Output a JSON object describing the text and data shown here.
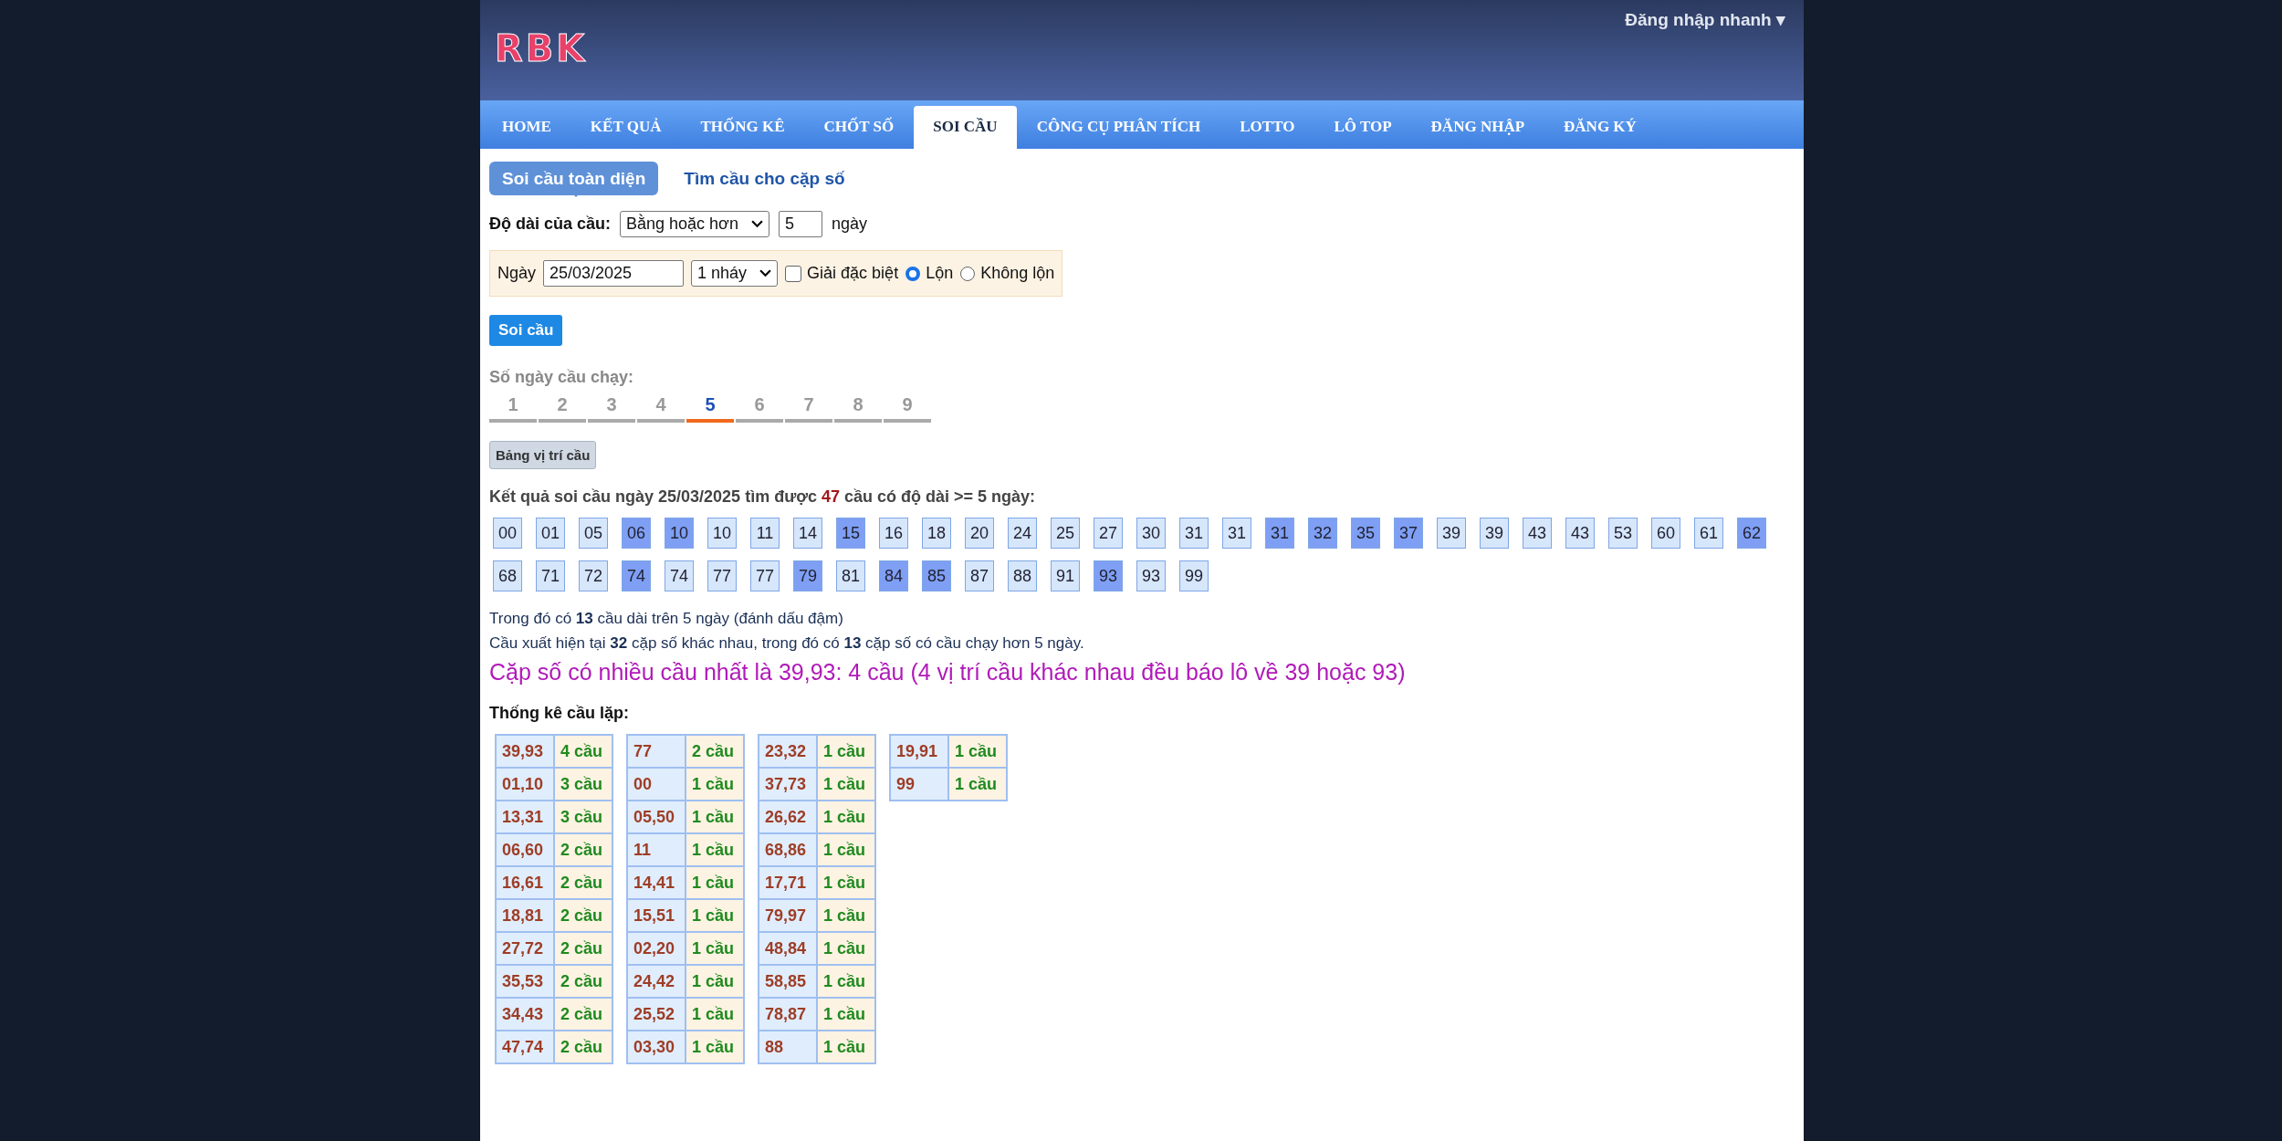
{
  "header": {
    "logo": "RBK",
    "login_menu": "Đăng nhập nhanh ▾"
  },
  "nav": [
    {
      "label": "HOME",
      "selected": false
    },
    {
      "label": "KẾT QUẢ",
      "selected": false
    },
    {
      "label": "THỐNG KÊ",
      "selected": false
    },
    {
      "label": "CHỐT SỐ",
      "selected": false
    },
    {
      "label": "SOI CẦU",
      "selected": true
    },
    {
      "label": "CÔNG CỤ PHÂN TÍCH",
      "selected": false
    },
    {
      "label": "LOTTO",
      "selected": false
    },
    {
      "label": "LÔ TOP",
      "selected": false
    },
    {
      "label": "ĐĂNG NHẬP",
      "selected": false
    },
    {
      "label": "ĐĂNG KÝ",
      "selected": false
    }
  ],
  "subtabs": [
    {
      "label": "Soi cầu toàn diện",
      "selected": true
    },
    {
      "label": "Tìm cầu cho cặp số",
      "selected": false
    }
  ],
  "length_row": {
    "label": "Độ dài của cầu:",
    "mode": "Bằng hoặc hơn",
    "days": "5",
    "unit": "ngày"
  },
  "date_row": {
    "label": "Ngày",
    "date": "25/03/2025",
    "step": "1 nháy",
    "options": [
      {
        "kind": "checkbox",
        "label": "Giải đặc biệt",
        "checked": false
      },
      {
        "kind": "radio",
        "label": "Lộn",
        "selected": true
      },
      {
        "kind": "radio",
        "label": "Không lộn",
        "selected": false
      }
    ]
  },
  "submit": "Soi cầu",
  "run_days": {
    "label": "Số ngày cầu chạy:",
    "items": [
      {
        "label": "1",
        "selected": false
      },
      {
        "label": "2",
        "selected": false
      },
      {
        "label": "3",
        "selected": false
      },
      {
        "label": "4",
        "selected": false
      },
      {
        "label": "5",
        "selected": true
      },
      {
        "label": "6",
        "selected": false
      },
      {
        "label": "7",
        "selected": false
      },
      {
        "label": "8",
        "selected": false
      },
      {
        "label": "9",
        "selected": false
      }
    ]
  },
  "position_button": "Bảng vị trí cầu",
  "result": {
    "summary": "Kết quả soi cầu ngày 25/03/2025 tìm được **47** cầu có độ dài >= 5 ngày:",
    "numbers": [
      {
        "value": "00",
        "highlighted": false
      },
      {
        "value": "01",
        "highlighted": false
      },
      {
        "value": "05",
        "highlighted": false
      },
      {
        "value": "06",
        "highlighted": true
      },
      {
        "value": "10",
        "highlighted": true
      },
      {
        "value": "10",
        "highlighted": false
      },
      {
        "value": "11",
        "highlighted": false
      },
      {
        "value": "14",
        "highlighted": false
      },
      {
        "value": "15",
        "highlighted": true
      },
      {
        "value": "16",
        "highlighted": false
      },
      {
        "value": "18",
        "highlighted": false
      },
      {
        "value": "20",
        "highlighted": false
      },
      {
        "value": "24",
        "highlighted": false
      },
      {
        "value": "25",
        "highlighted": false
      },
      {
        "value": "27",
        "highlighted": false
      },
      {
        "value": "30",
        "highlighted": false
      },
      {
        "value": "31",
        "highlighted": false
      },
      {
        "value": "31",
        "highlighted": false
      },
      {
        "value": "31",
        "highlighted": true
      },
      {
        "value": "32",
        "highlighted": true
      },
      {
        "value": "35",
        "highlighted": true
      },
      {
        "value": "37",
        "highlighted": true
      },
      {
        "value": "39",
        "highlighted": false
      },
      {
        "value": "39",
        "highlighted": false
      },
      {
        "value": "43",
        "highlighted": false
      },
      {
        "value": "43",
        "highlighted": false
      },
      {
        "value": "53",
        "highlighted": false
      },
      {
        "value": "60",
        "highlighted": false
      },
      {
        "value": "61",
        "highlighted": false
      },
      {
        "value": "62",
        "highlighted": true
      },
      {
        "value": "68",
        "highlighted": false
      },
      {
        "value": "71",
        "highlighted": false
      },
      {
        "value": "72",
        "highlighted": false
      },
      {
        "value": "74",
        "highlighted": true
      },
      {
        "value": "74",
        "highlighted": false
      },
      {
        "value": "77",
        "highlighted": false
      },
      {
        "value": "77",
        "highlighted": false
      },
      {
        "value": "79",
        "highlighted": true
      },
      {
        "value": "81",
        "highlighted": false
      },
      {
        "value": "84",
        "highlighted": true
      },
      {
        "value": "85",
        "highlighted": true
      },
      {
        "value": "87",
        "highlighted": false
      },
      {
        "value": "88",
        "highlighted": false
      },
      {
        "value": "91",
        "highlighted": false
      },
      {
        "value": "93",
        "highlighted": true
      },
      {
        "value": "93",
        "highlighted": false
      },
      {
        "value": "99",
        "highlighted": false
      }
    ],
    "notes": [
      "Trong đó có **13** cầu dài trên 5 ngày (đánh dấu đậm)",
      "Cầu xuất hiện tại **32** cặp số khác nhau, trong đó có **13** cặp số có cầu chạy hơn 5 ngày."
    ],
    "highlight": "Cặp số có nhiều cầu nhất là 39,93: 4 cầu (4 vị trí cầu khác nhau đều báo lô về 39 hoặc 93)"
  },
  "repeat_stats": {
    "title": "Thống kê cầu lặp:",
    "tables": [
      [
        {
          "pair": "39,93",
          "count": "4 cầu"
        },
        {
          "pair": "01,10",
          "count": "3 cầu"
        },
        {
          "pair": "13,31",
          "count": "3 cầu"
        },
        {
          "pair": "06,60",
          "count": "2 cầu"
        },
        {
          "pair": "16,61",
          "count": "2 cầu"
        },
        {
          "pair": "18,81",
          "count": "2 cầu"
        },
        {
          "pair": "27,72",
          "count": "2 cầu"
        },
        {
          "pair": "35,53",
          "count": "2 cầu"
        },
        {
          "pair": "34,43",
          "count": "2 cầu"
        },
        {
          "pair": "47,74",
          "count": "2 cầu"
        }
      ],
      [
        {
          "pair": "77",
          "count": "2 cầu"
        },
        {
          "pair": "00",
          "count": "1 cầu"
        },
        {
          "pair": "05,50",
          "count": "1 cầu"
        },
        {
          "pair": "11",
          "count": "1 cầu"
        },
        {
          "pair": "14,41",
          "count": "1 cầu"
        },
        {
          "pair": "15,51",
          "count": "1 cầu"
        },
        {
          "pair": "02,20",
          "count": "1 cầu"
        },
        {
          "pair": "24,42",
          "count": "1 cầu"
        },
        {
          "pair": "25,52",
          "count": "1 cầu"
        },
        {
          "pair": "03,30",
          "count": "1 cầu"
        }
      ],
      [
        {
          "pair": "23,32",
          "count": "1 cầu"
        },
        {
          "pair": "37,73",
          "count": "1 cầu"
        },
        {
          "pair": "26,62",
          "count": "1 cầu"
        },
        {
          "pair": "68,86",
          "count": "1 cầu"
        },
        {
          "pair": "17,71",
          "count": "1 cầu"
        },
        {
          "pair": "79,97",
          "count": "1 cầu"
        },
        {
          "pair": "48,84",
          "count": "1 cầu"
        },
        {
          "pair": "58,85",
          "count": "1 cầu"
        },
        {
          "pair": "78,87",
          "count": "1 cầu"
        },
        {
          "pair": "88",
          "count": "1 cầu"
        }
      ],
      [
        {
          "pair": "19,91",
          "count": "1 cầu"
        },
        {
          "pair": "99",
          "count": "1 cầu"
        }
      ]
    ]
  }
}
